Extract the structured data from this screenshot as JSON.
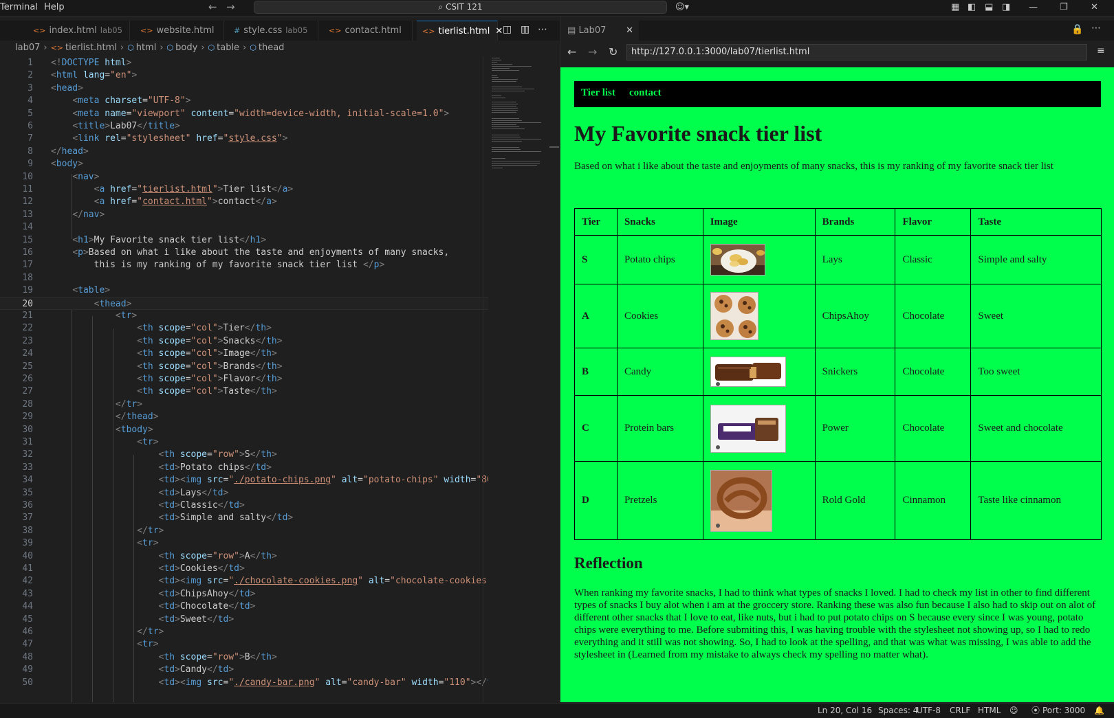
{
  "titlebar": {
    "menu": [
      "Terminal",
      "Help"
    ],
    "command_center": "CSIT 121"
  },
  "editor_tabs": [
    {
      "label": "index.html",
      "desc": "lab05"
    },
    {
      "label": "website.html",
      "desc": ""
    },
    {
      "label": "style.css",
      "desc": "lab05"
    },
    {
      "label": "contact.html",
      "desc": ""
    },
    {
      "label": "tierlist.html",
      "desc": ""
    }
  ],
  "breadcrumb": [
    "lab07",
    "tierlist.html",
    "html",
    "body",
    "table",
    "thead"
  ],
  "code": {
    "current_line": 20,
    "line_count": 50
  },
  "browser": {
    "tab_title": "Lab07",
    "url": "http://127.0.0.1:3000/lab07/tierlist.html"
  },
  "page": {
    "nav": [
      "Tier list",
      "contact"
    ],
    "h1": "My Favorite snack tier list",
    "intro": "Based on what i like about the taste and enjoyments of many snacks, this is my ranking of my favorite snack tier list",
    "table": {
      "headers": [
        "Tier",
        "Snacks",
        "Image",
        "Brands",
        "Flavor",
        "Taste"
      ],
      "rows": [
        {
          "tier": "S",
          "snack": "Potato chips",
          "image": "potato-chips",
          "brand": "Lays",
          "flavor": "Classic",
          "taste": "Simple and salty"
        },
        {
          "tier": "A",
          "snack": "Cookies",
          "image": "chocolate-cookies",
          "brand": "ChipsAhoy",
          "flavor": "Chocolate",
          "taste": "Sweet"
        },
        {
          "tier": "B",
          "snack": "Candy",
          "image": "candy-bar",
          "brand": "Snickers",
          "flavor": "Chocolate",
          "taste": "Too sweet"
        },
        {
          "tier": "C",
          "snack": "Protein bars",
          "image": "protein-bar",
          "brand": "Power",
          "flavor": "Chocolate",
          "taste": "Sweet and chocolate"
        },
        {
          "tier": "D",
          "snack": "Pretzels",
          "image": "pretzel",
          "brand": "Rold Gold",
          "flavor": "Cinnamon",
          "taste": "Taste like cinnamon"
        }
      ]
    },
    "h2": "Reflection",
    "reflection": "When ranking my favorite snacks, I had to think what types of snacks I loved. I had to check my list in other to find different types of snacks I buy alot when i am at the groccery store. Ranking these was also fun because I also had to skip out on alot of different other snacks that I love to eat, like nuts, but i had to put potato chips on S because every since I was young, potato chips were everything to me. Before submiting this, I was having trouble with the stylesheet not showing up, so I had to redo everything and it still was not showing. So, I had to look at the spelling, and that was what was missing, I was able to add the stylesheet in (Learned from my mistake to always check my spelling no matter what)."
  },
  "statusbar": {
    "position": "Ln 20, Col 16",
    "spaces": "Spaces: 4",
    "encoding": "UTF-8",
    "eol": "CRLF",
    "language": "HTML",
    "port": "Port: 3000"
  },
  "colors": {
    "page_bg": "#00ff4c",
    "nav_bg": "#000000",
    "editor_bg": "#1f1f1f",
    "accent": "#0078d4"
  }
}
